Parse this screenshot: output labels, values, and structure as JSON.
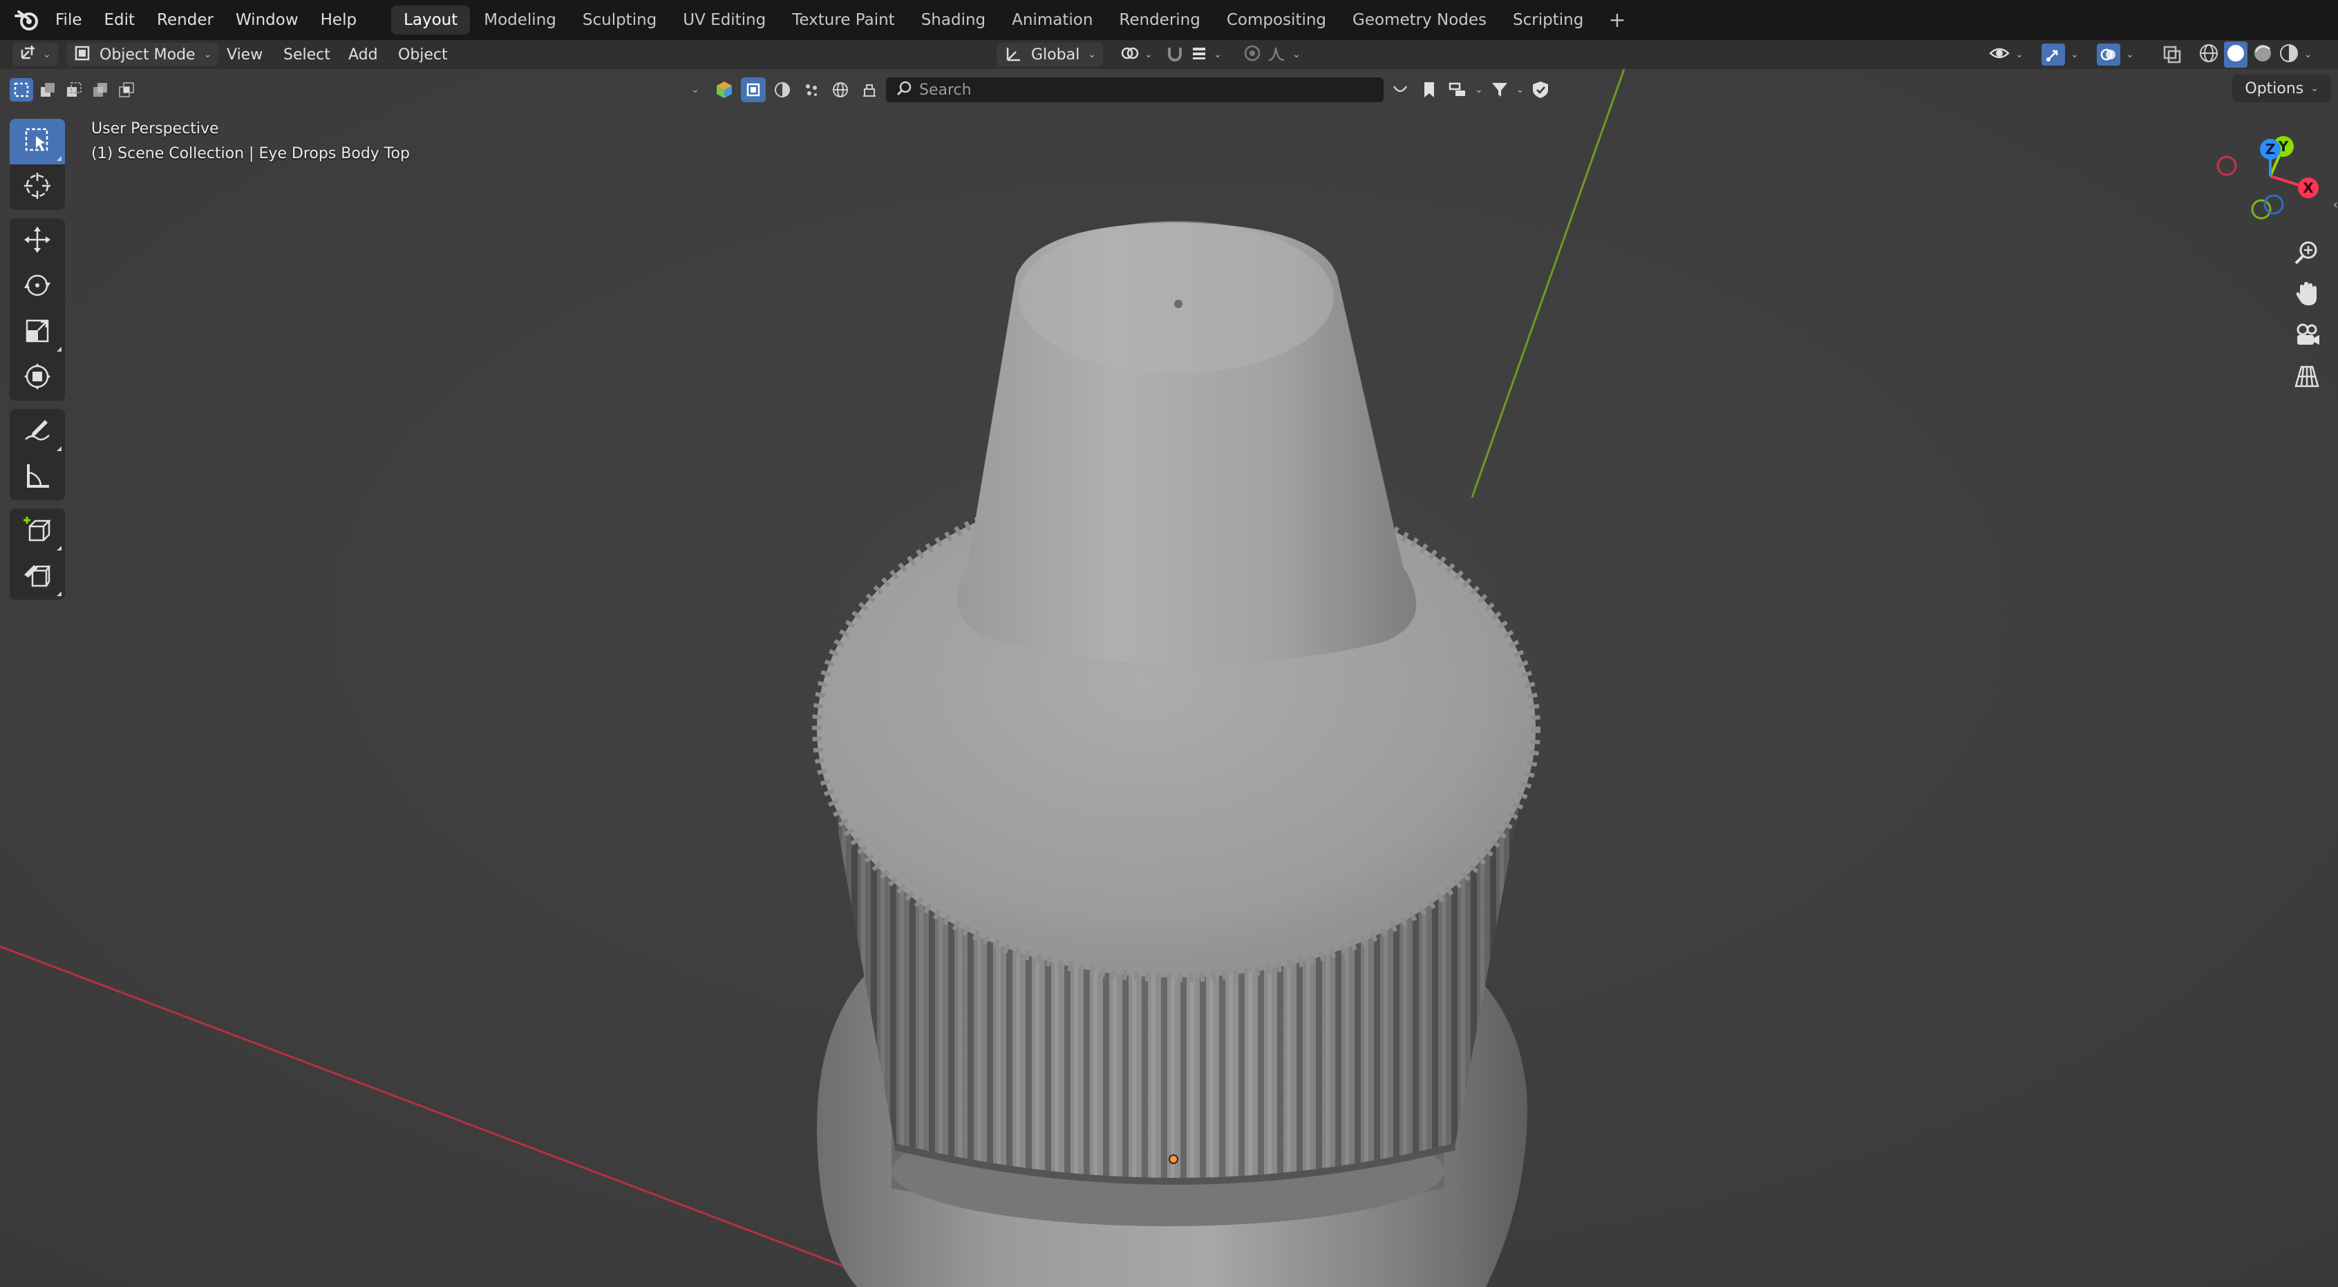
{
  "app": {
    "name": "Blender",
    "colors": {
      "topbar": "#181818",
      "header": "#303030",
      "viewport": "#3d3d3d",
      "accent": "#4772b3",
      "x_axis": "#ff3352",
      "y_axis": "#8bdc00",
      "z_axis": "#2c8fff"
    }
  },
  "menu": [
    "File",
    "Edit",
    "Render",
    "Window",
    "Help"
  ],
  "workspaces": {
    "active": "Layout",
    "tabs": [
      "Layout",
      "Modeling",
      "Sculpting",
      "UV Editing",
      "Texture Paint",
      "Shading",
      "Animation",
      "Rendering",
      "Compositing",
      "Geometry Nodes",
      "Scripting"
    ],
    "add_symbol": "+"
  },
  "header": {
    "editor_type_icon": "3d-viewport-icon",
    "mode": "Object Mode",
    "menus": [
      "View",
      "Select",
      "Add",
      "Object"
    ],
    "transform_orientation": "Global",
    "pivot_icon": "pivot-point-icon",
    "snap_icon": "snap-magnet-icon",
    "proportional_icon": "proportional-edit-icon",
    "shading_modes": [
      "wireframe",
      "solid",
      "material-preview",
      "rendered"
    ],
    "active_shading": "solid"
  },
  "filterbar": {
    "search_placeholder": "Search"
  },
  "options": {
    "label": "Options"
  },
  "tools": [
    "select-box",
    "cursor",
    "move",
    "rotate",
    "scale",
    "transform",
    "annotate",
    "measure",
    "add-cube",
    "knife-tool"
  ],
  "active_tool": "select-box",
  "viewport": {
    "perspective": "User Perspective",
    "collection_info": "(1) Scene Collection | Eye Drops Body Top"
  },
  "gizmo": {
    "axes": [
      "X",
      "Y",
      "Z"
    ],
    "nav_buttons": [
      "zoom",
      "pan",
      "camera",
      "grid"
    ]
  }
}
